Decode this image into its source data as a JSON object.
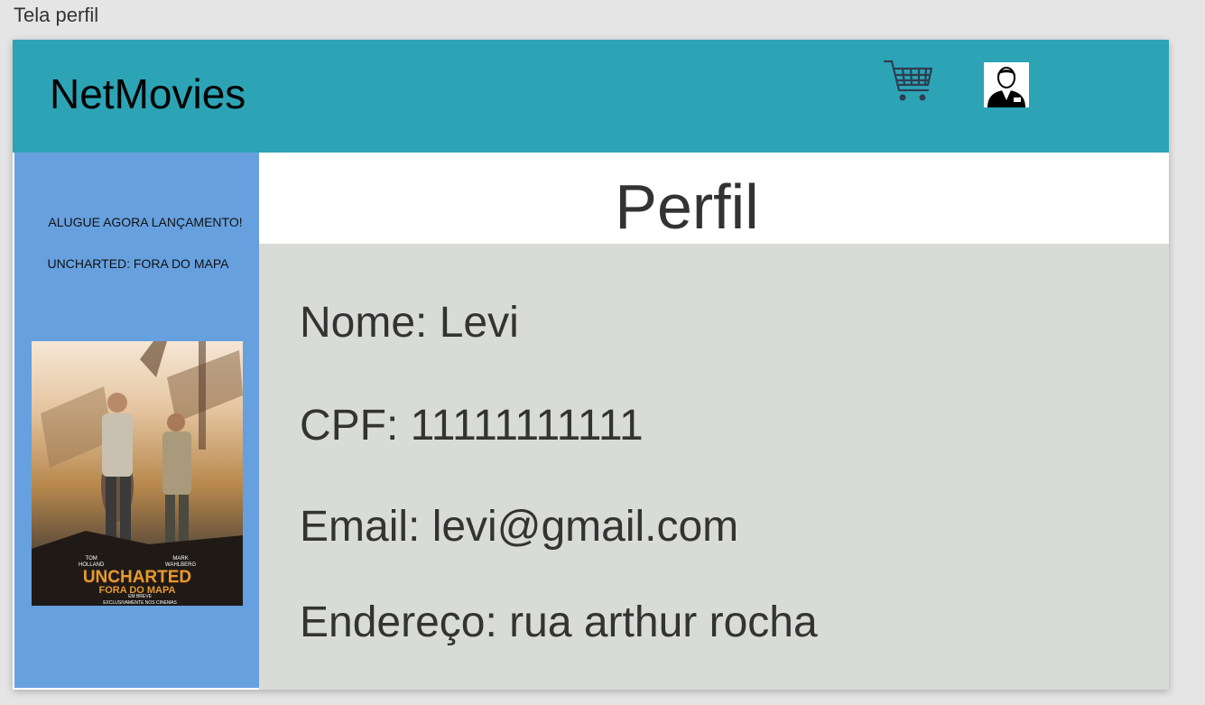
{
  "frame_label": "Tela perfil",
  "header": {
    "brand": "NetMovies",
    "cart_icon": "shopping-cart-icon",
    "avatar_icon": "user-avatar-icon"
  },
  "sidebar": {
    "promo_line1": "ALUGUE AGORA LANÇAMENTO!",
    "promo_line2": "UNCHARTED: FORA DO MAPA",
    "poster": {
      "title": "UNCHARTED",
      "subtitle": "FORA DO MAPA",
      "actor_left": "TOM\nHOLLAND",
      "actor_right": "MARK\nWAHLBERG",
      "tagline": "EM BREVE\nEXCLUSIVAMENTE NOS CINEMAS"
    }
  },
  "profile": {
    "title": "Perfil",
    "fields": [
      "Nome: Levi",
      "CPF: 11111111111",
      "Email: levi@gmail.com",
      "Endereço: rua arthur rocha"
    ]
  },
  "colors": {
    "header": "#2ca4b6",
    "sidebar": "#67a0df",
    "panel": "#d9dbd7"
  }
}
